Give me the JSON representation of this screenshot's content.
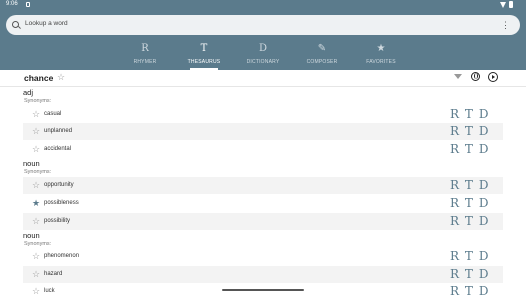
{
  "status": {
    "time": "9:06"
  },
  "search": {
    "placeholder": "Lookup a word"
  },
  "tabs": [
    {
      "icon": "rhymer-icon",
      "glyph": "R",
      "label": "RHYMER",
      "active": false
    },
    {
      "icon": "thesaurus-icon",
      "glyph": "T",
      "label": "THESAURUS",
      "active": true
    },
    {
      "icon": "dictionary-icon",
      "glyph": "D",
      "label": "DICTIONARY",
      "active": false
    },
    {
      "icon": "pencil-icon",
      "glyph": "✎",
      "label": "COMPOSER",
      "active": false
    },
    {
      "icon": "star-icon",
      "glyph": "★",
      "label": "FAVORITES",
      "active": false
    }
  ],
  "header": {
    "word": "chance"
  },
  "sections": [
    {
      "pos": "adj",
      "synonyms_label": "Synonyms:",
      "words": [
        {
          "text": "casual",
          "favorite": false
        },
        {
          "text": "unplanned",
          "favorite": false
        },
        {
          "text": "accidental",
          "favorite": false
        }
      ]
    },
    {
      "pos": "noun",
      "synonyms_label": "Synonyms:",
      "words": [
        {
          "text": "opportunity",
          "favorite": false
        },
        {
          "text": "possibleness",
          "favorite": true
        },
        {
          "text": "possibility",
          "favorite": false
        }
      ]
    },
    {
      "pos": "noun",
      "synonyms_label": "Synonyms:",
      "words": [
        {
          "text": "phenomenon",
          "favorite": false
        },
        {
          "text": "hazard",
          "favorite": false
        },
        {
          "text": "luck",
          "favorite": false
        }
      ]
    }
  ],
  "row_actions": {
    "rhymer": "R",
    "thesaurus": "T",
    "dictionary": "D"
  },
  "colors": {
    "accent": "#5b7b8c",
    "topbar": "#5b7b8c"
  }
}
